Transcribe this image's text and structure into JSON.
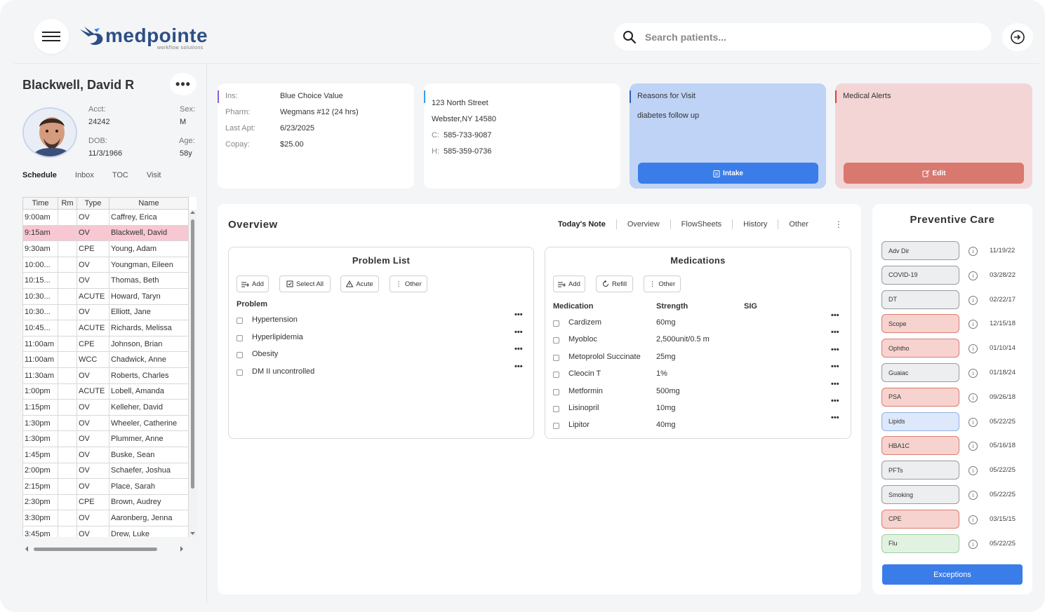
{
  "app": {
    "logo_text": "medpointe",
    "logo_sub": "workflow solutions",
    "search_placeholder": "Search patients...",
    "colors": {
      "primary": "#3a7de8",
      "brand": "#2d4f86",
      "selected_row": "#f7c7d2",
      "alert_bg": "#f3d5d6",
      "alert_btn": "#d9786f",
      "visit_bg": "#bed3f6"
    }
  },
  "patient": {
    "name": "Blackwell, David R",
    "acct_label": "Acct:",
    "acct": "24242",
    "sex_label": "Sex:",
    "sex": "M",
    "dob_label": "DOB:",
    "dob": "11/3/1966",
    "age_label": "Age:",
    "age": "58y"
  },
  "left_tabs": [
    "Schedule",
    "Inbox",
    "TOC",
    "Visit"
  ],
  "schedule": {
    "headers": [
      "Time",
      "Rm",
      "Type",
      "Name"
    ],
    "rows": [
      [
        "9:00am",
        "",
        "OV",
        "Caffrey, Erica"
      ],
      [
        "9:15am",
        "",
        "OV",
        "Blackwell, David"
      ],
      [
        "9:30am",
        "",
        "CPE",
        "Young, Adam"
      ],
      [
        "10:00...",
        "",
        "OV",
        "Youngman, Eileen"
      ],
      [
        "10:15...",
        "",
        "OV",
        "Thomas, Beth"
      ],
      [
        "10:30...",
        "",
        "ACUTE",
        "Howard, Taryn"
      ],
      [
        "10:30...",
        "",
        "OV",
        "Elliott, Jane"
      ],
      [
        "10:45...",
        "",
        "ACUTE",
        "Richards, Melissa"
      ],
      [
        "11:00am",
        "",
        "CPE",
        "Johnson, Brian"
      ],
      [
        "11:00am",
        "",
        "WCC",
        "Chadwick, Anne"
      ],
      [
        "11:30am",
        "",
        "OV",
        "Roberts, Charles"
      ],
      [
        "1:00pm",
        "",
        "ACUTE",
        "Lobell, Amanda"
      ],
      [
        "1:15pm",
        "",
        "OV",
        "Kelleher, David"
      ],
      [
        "1:30pm",
        "",
        "OV",
        "Wheeler, Catherine"
      ],
      [
        "1:30pm",
        "",
        "OV",
        "Plummer, Anne"
      ],
      [
        "1:45pm",
        "",
        "OV",
        "Buske, Sean"
      ],
      [
        "2:00pm",
        "",
        "OV",
        "Schaefer, Joshua"
      ],
      [
        "2:15pm",
        "",
        "OV",
        "Place, Sarah"
      ],
      [
        "2:30pm",
        "",
        "CPE",
        "Brown, Audrey"
      ],
      [
        "3:30pm",
        "",
        "OV",
        "Aaronberg, Jenna"
      ],
      [
        "3:45pm",
        "",
        "OV",
        "Drew, Luke"
      ]
    ]
  },
  "insurance": {
    "ins_label": "Ins:",
    "ins": "Blue Choice Value",
    "pharm_label": "Pharm:",
    "pharm": "Wegmans #12 (24 hrs)",
    "last_label": "Last Apt:",
    "last": "6/23/2025",
    "copay_label": "Copay:",
    "copay": "$25.00"
  },
  "address": {
    "street": "123 North Street",
    "city": "Webster,NY 14580",
    "c_label": "C:",
    "cell": "585-733-9087",
    "h_label": "H:",
    "home": "585-359-0736"
  },
  "visit": {
    "title": "Reasons for Visit",
    "text": "diabetes follow up",
    "button": "Intake"
  },
  "alerts": {
    "title": "Medical Alerts",
    "button": "Edit"
  },
  "overview": {
    "title": "Overview",
    "tabs": [
      "Today's Note",
      "Overview",
      "FlowSheets",
      "History",
      "Other"
    ],
    "kebab": "⋮"
  },
  "problems": {
    "title": "Problem List",
    "buttons": [
      "Add",
      "Select All",
      "Acute",
      "Other"
    ],
    "header": "Problem",
    "items": [
      "Hypertension",
      "Hyperlipidemia",
      "Obesity",
      "DM II uncontrolled"
    ]
  },
  "medications": {
    "title": "Medications",
    "buttons": [
      "Add",
      "Refill",
      "Other"
    ],
    "headers": [
      "Medication",
      "Strength",
      "SIG"
    ],
    "items": [
      {
        "name": "Cardizem",
        "strength": "60mg"
      },
      {
        "name": "Myobloc",
        "strength": "2,500unit/0.5 m"
      },
      {
        "name": "Metoprolol Succinate",
        "strength": "25mg"
      },
      {
        "name": "Cleocin T",
        "strength": "1%"
      },
      {
        "name": "Metformin",
        "strength": "500mg"
      },
      {
        "name": "Lisinopril",
        "strength": "10mg"
      },
      {
        "name": "Lipitor",
        "strength": "40mg"
      }
    ]
  },
  "preventive": {
    "title": "Preventive Care",
    "items": [
      {
        "label": "Adv Dir",
        "date": "11/19/22",
        "status": "neutral"
      },
      {
        "label": "COVID-19",
        "date": "03/28/22",
        "status": "neutral"
      },
      {
        "label": "DT",
        "date": "02/22/17",
        "status": "neutral"
      },
      {
        "label": "Scope",
        "date": "12/15/18",
        "status": "overdue"
      },
      {
        "label": "Ophtho",
        "date": "01/10/14",
        "status": "overdue"
      },
      {
        "label": "Guaiac",
        "date": "01/18/24",
        "status": "neutral"
      },
      {
        "label": "PSA",
        "date": "09/26/18",
        "status": "overdue"
      },
      {
        "label": "Lipids",
        "date": "05/22/25",
        "status": "current"
      },
      {
        "label": "HBA1C",
        "date": "05/16/18",
        "status": "overdue"
      },
      {
        "label": "PFTs",
        "date": "05/22/25",
        "status": "neutral"
      },
      {
        "label": "Smoking",
        "date": "05/22/25",
        "status": "neutral"
      },
      {
        "label": "CPE",
        "date": "03/15/15",
        "status": "overdue"
      },
      {
        "label": "Flu",
        "date": "05/22/25",
        "status": "good"
      }
    ],
    "button": "Exceptions"
  }
}
